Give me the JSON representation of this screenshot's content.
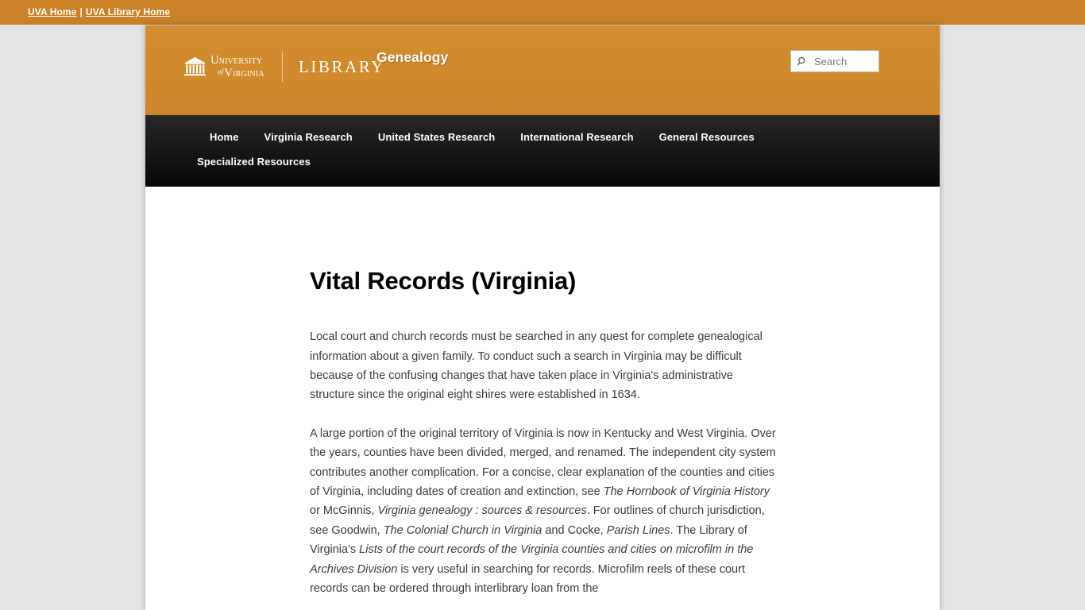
{
  "topbar": {
    "links": [
      {
        "label": "UVA Home"
      },
      {
        "label": "UVA Library Home"
      }
    ],
    "separator": "|"
  },
  "header": {
    "brand": {
      "icon": "rotunda-icon",
      "line1": "University",
      "of": "of",
      "line2": "Virginia",
      "library": "LIBRARY"
    },
    "site_title": "Genealogy",
    "search": {
      "icon": "search-icon",
      "placeholder": "Search",
      "value": ""
    },
    "background_color": "#d08a2c"
  },
  "nav": {
    "items": [
      {
        "label": "Home"
      },
      {
        "label": "Virginia Research"
      },
      {
        "label": "United States Research"
      },
      {
        "label": "International Research"
      },
      {
        "label": "General Resources"
      },
      {
        "label": "Specialized Resources"
      }
    ],
    "background_color": "#151515",
    "accent_color": "#c9801f"
  },
  "main": {
    "page_title": "Vital Records (Virginia)",
    "paragraphs": {
      "p1": "Local court and church records must be searched in any quest for complete genealogical information about a given family. To conduct such a search in Virginia may be difficult because of the confusing changes that have taken place in Virginia's administrative structure since the original eight shires were established in 1634.",
      "p2_a": "A large portion of the original territory of Virginia is now in Kentucky and West Virginia. Over the years, counties have been divided, merged, and renamed. The independent city system contributes another complication. For a concise, clear explanation of the counties and cities of Virginia, including dates of creation and extinction, see ",
      "p2_title1": "The Hornbook of Virginia History",
      "p2_b": " or McGinnis, ",
      "p2_title2": "Virginia genealogy : sources & resources",
      "p2_c": ". For outlines of church jurisdiction, see Goodwin, ",
      "p2_title3": "The Colonial Church in Virginia",
      "p2_d": " and Cocke, ",
      "p2_title4": "Parish Lines",
      "p2_e": ". The Library of Virginia's ",
      "p2_title5": "Lists of the court records of the Virginia counties and cities on microfilm in the Archives Division",
      "p2_f": " is very useful in searching for records. Microfilm reels of these court records can be ordered through interlibrary loan from the"
    }
  }
}
